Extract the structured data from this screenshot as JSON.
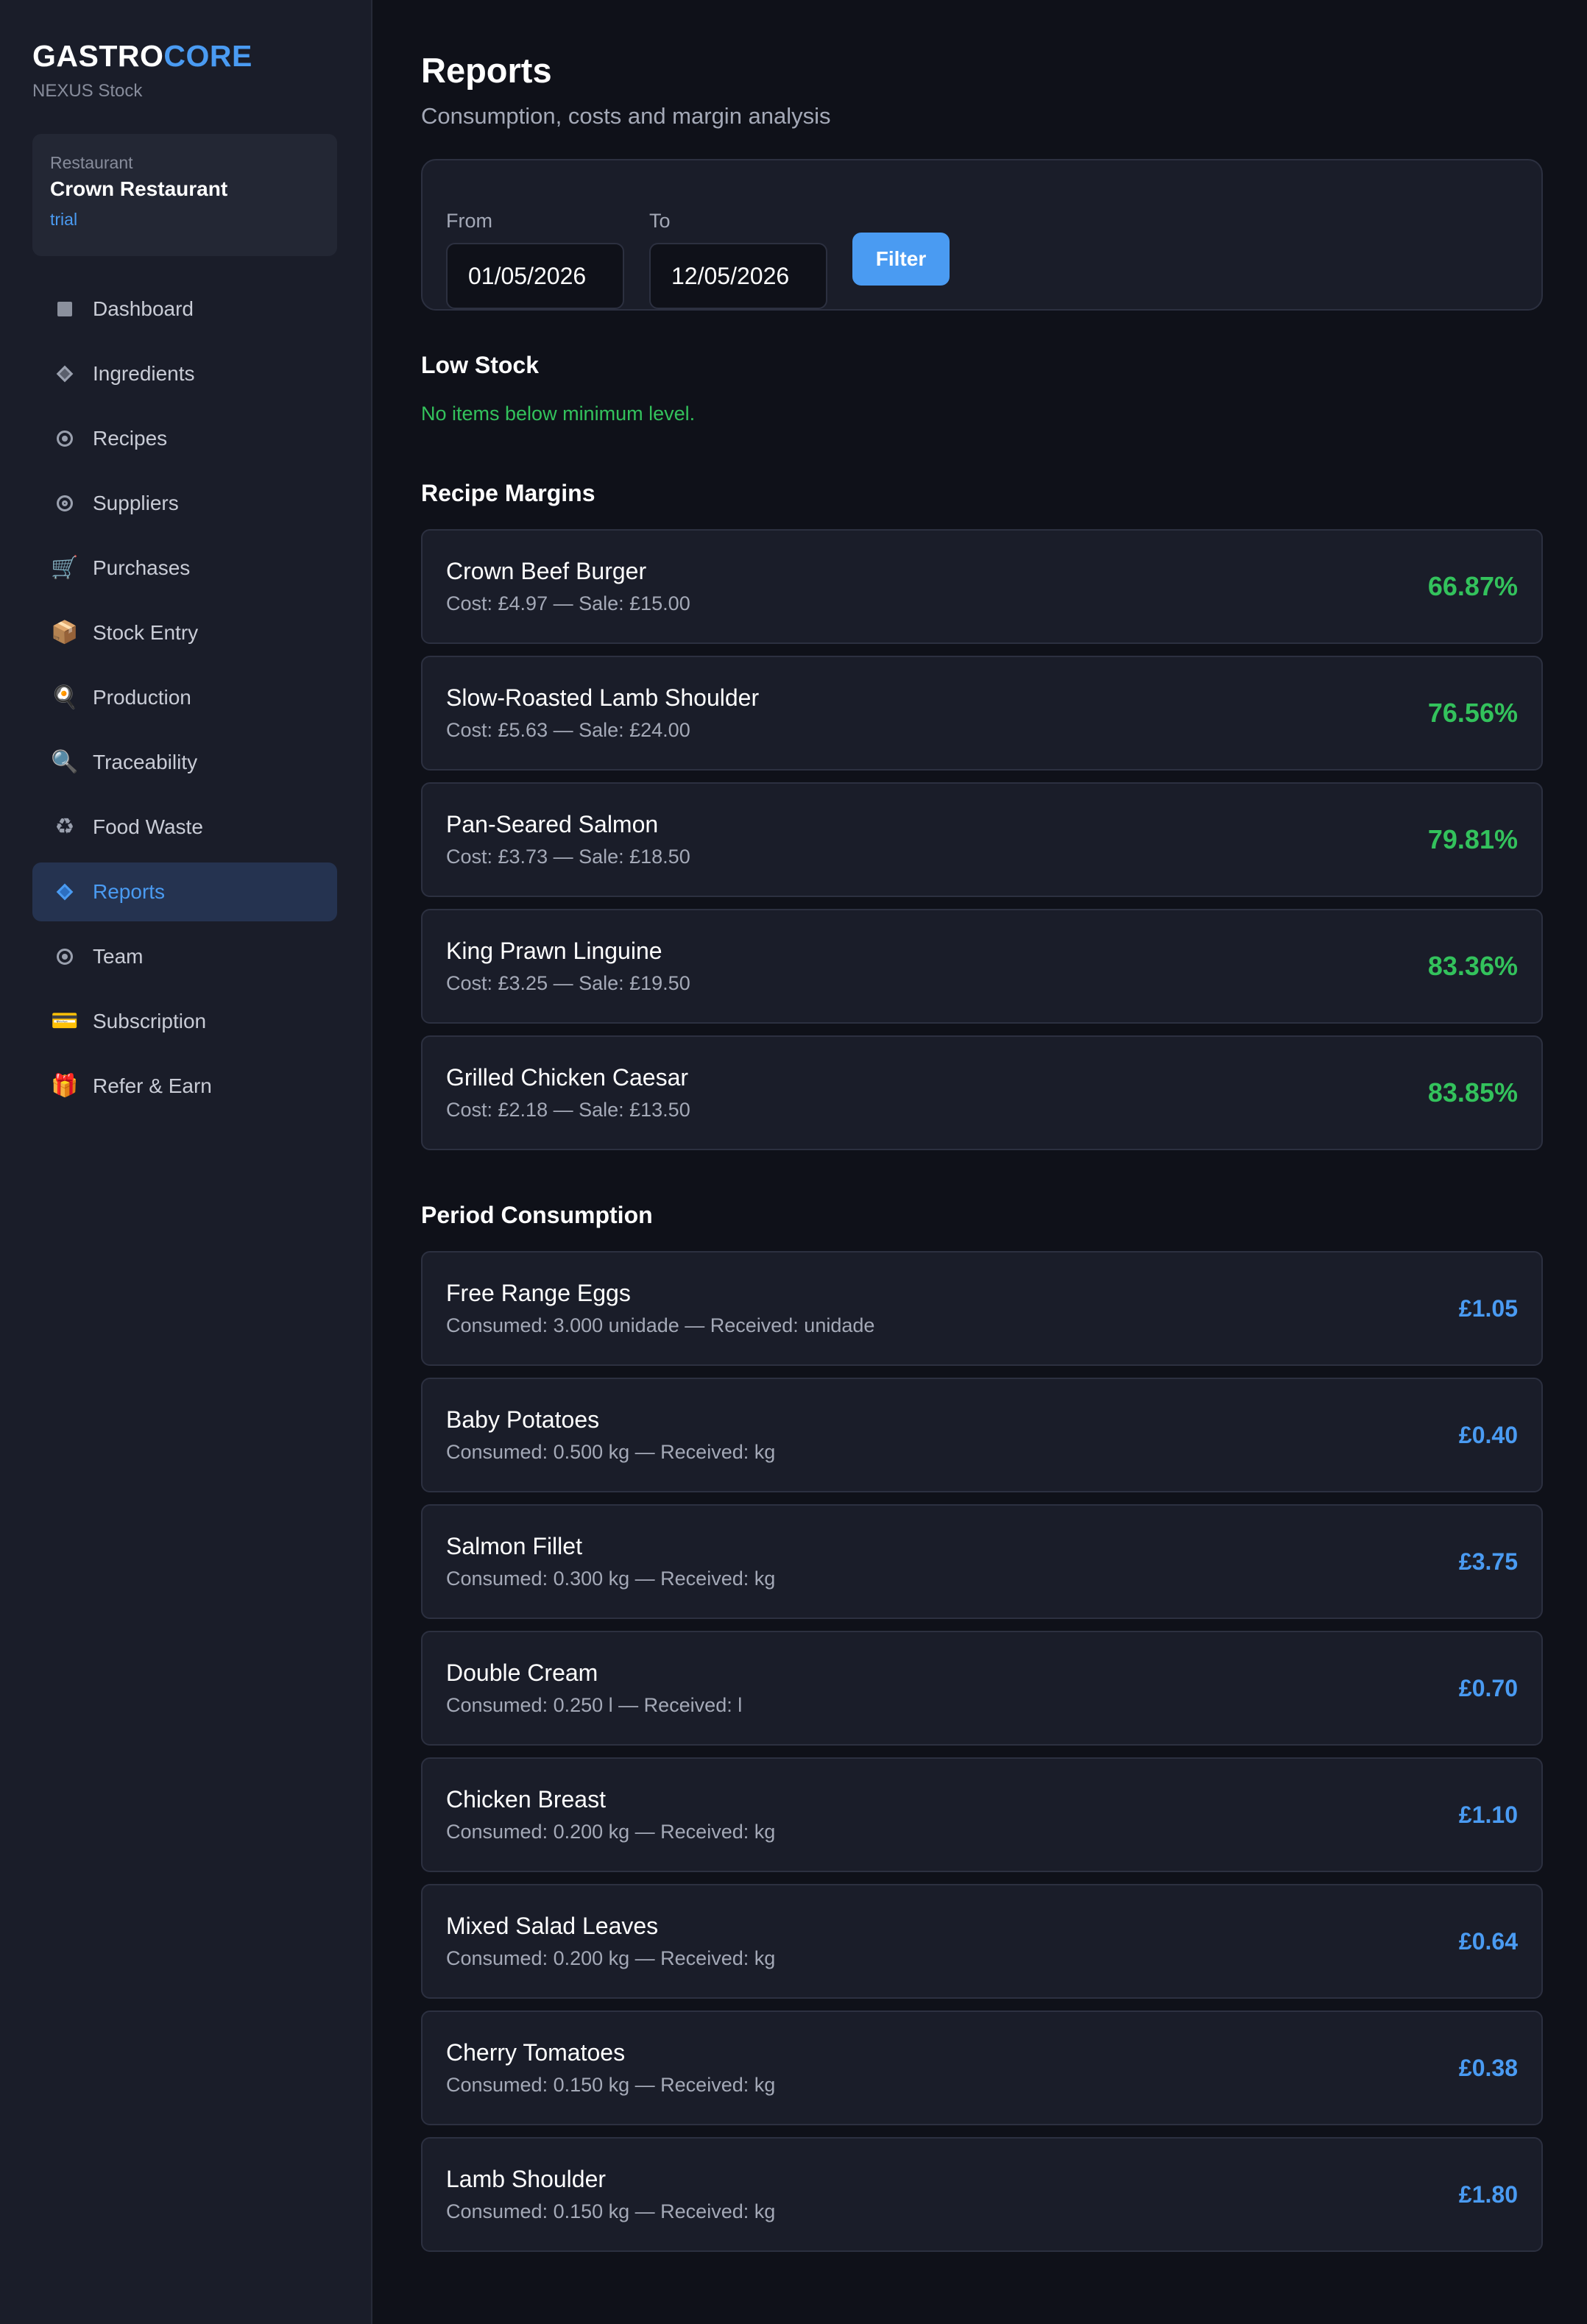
{
  "brand": {
    "part1": "GASTRO",
    "part2": "CORE",
    "subtitle": "NEXUS Stock"
  },
  "restaurant": {
    "label": "Restaurant",
    "name": "Crown Restaurant",
    "plan": "trial"
  },
  "nav": [
    {
      "label": "Dashboard",
      "icon": "square-icon"
    },
    {
      "label": "Ingredients",
      "icon": "diamond-icon"
    },
    {
      "label": "Recipes",
      "icon": "dot-icon"
    },
    {
      "label": "Suppliers",
      "icon": "ring-icon"
    },
    {
      "label": "Purchases",
      "icon": "cart-icon"
    },
    {
      "label": "Stock Entry",
      "icon": "package-icon"
    },
    {
      "label": "Production",
      "icon": "lollipop-icon"
    },
    {
      "label": "Traceability",
      "icon": "magnifier-icon"
    },
    {
      "label": "Food Waste",
      "icon": "recycle-icon"
    },
    {
      "label": "Reports",
      "icon": "diamond-icon",
      "active": true
    },
    {
      "label": "Team",
      "icon": "dot-icon"
    },
    {
      "label": "Subscription",
      "icon": "credit-card-icon"
    },
    {
      "label": "Refer & Earn",
      "icon": "gift-icon"
    }
  ],
  "page": {
    "title": "Reports",
    "subtitle": "Consumption, costs and margin analysis"
  },
  "filter": {
    "from_label": "From",
    "from_value": "01/05/2026",
    "to_label": "To",
    "to_value": "12/05/2026",
    "button": "Filter"
  },
  "low_stock": {
    "title": "Low Stock",
    "message": "No items below minimum level."
  },
  "margins": {
    "title": "Recipe Margins",
    "items": [
      {
        "name": "Crown Beef Burger",
        "meta": "Cost: £4.97 — Sale: £15.00",
        "value": "66.87%"
      },
      {
        "name": "Slow-Roasted Lamb Shoulder",
        "meta": "Cost: £5.63 — Sale: £24.00",
        "value": "76.56%"
      },
      {
        "name": "Pan-Seared Salmon",
        "meta": "Cost: £3.73 — Sale: £18.50",
        "value": "79.81%"
      },
      {
        "name": "King Prawn Linguine",
        "meta": "Cost: £3.25 — Sale: £19.50",
        "value": "83.36%"
      },
      {
        "name": "Grilled Chicken Caesar",
        "meta": "Cost: £2.18 — Sale: £13.50",
        "value": "83.85%"
      }
    ]
  },
  "consumption": {
    "title": "Period Consumption",
    "items": [
      {
        "name": "Free Range Eggs",
        "meta": "Consumed: 3.000 unidade — Received: unidade",
        "value": "£1.05"
      },
      {
        "name": "Baby Potatoes",
        "meta": "Consumed: 0.500 kg — Received: kg",
        "value": "£0.40"
      },
      {
        "name": "Salmon Fillet",
        "meta": "Consumed: 0.300 kg — Received: kg",
        "value": "£3.75"
      },
      {
        "name": "Double Cream",
        "meta": "Consumed: 0.250 l — Received: l",
        "value": "£0.70"
      },
      {
        "name": "Chicken Breast",
        "meta": "Consumed: 0.200 kg — Received: kg",
        "value": "£1.10"
      },
      {
        "name": "Mixed Salad Leaves",
        "meta": "Consumed: 0.200 kg — Received: kg",
        "value": "£0.64"
      },
      {
        "name": "Cherry Tomatoes",
        "meta": "Consumed: 0.150 kg — Received: kg",
        "value": "£0.38"
      },
      {
        "name": "Lamb Shoulder",
        "meta": "Consumed: 0.150 kg — Received: kg",
        "value": "£1.80"
      }
    ]
  },
  "colors": {
    "accent": "#4a9bf2",
    "success": "#33c25c",
    "background": "#0f1119",
    "sidebar": "#1a1d29"
  }
}
